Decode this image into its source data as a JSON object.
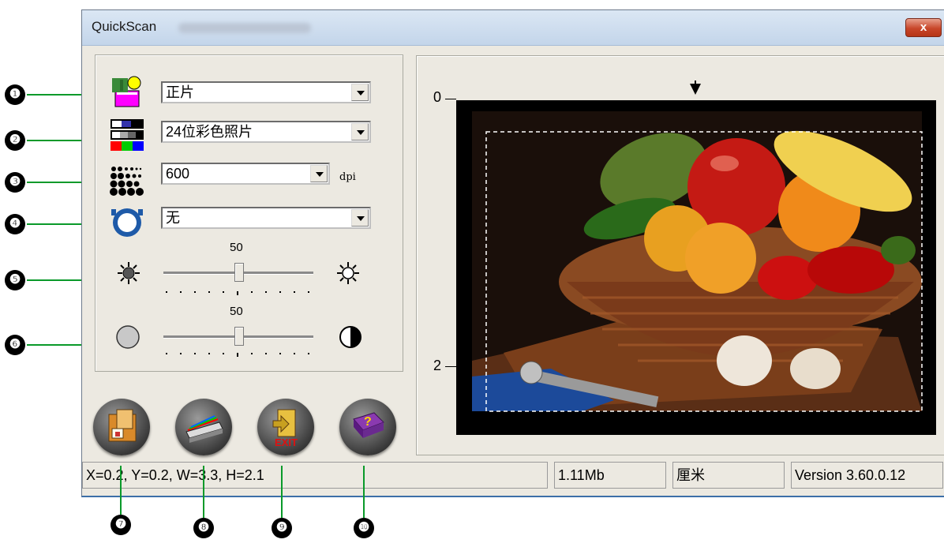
{
  "window": {
    "title": "QuickScan",
    "close_label": "x"
  },
  "settings": {
    "type": {
      "value": "正片",
      "icon": "film-type-icon"
    },
    "mode": {
      "value": "24位彩色照片",
      "icon": "color-mode-icon"
    },
    "resolution": {
      "value": "600",
      "unit": "dpi",
      "icon": "resolution-icon"
    },
    "filter": {
      "value": "无",
      "icon": "lens-filter-icon"
    }
  },
  "brightness": {
    "value": 50,
    "min": 0,
    "max": 100,
    "value_label": "50"
  },
  "contrast": {
    "value": 50,
    "min": 0,
    "max": 100,
    "value_label": "50"
  },
  "ruler": {
    "labels": [
      "0",
      "2"
    ]
  },
  "buttons": [
    {
      "name": "manager",
      "icon": "folder-manager-icon"
    },
    {
      "name": "scan",
      "icon": "scanner-icon"
    },
    {
      "name": "exit",
      "icon": "exit-door-icon"
    },
    {
      "name": "help",
      "icon": "help-book-icon"
    }
  ],
  "status": {
    "coords": "X=0.2, Y=0.2, W=3.3, H=2.1",
    "size": "1.11Mb",
    "unit": "厘米",
    "version": "Version 3.60.0.12"
  },
  "callouts": [
    "❶",
    "❷",
    "❸",
    "❹",
    "❺",
    "❻",
    "❼",
    "❽",
    "❾",
    "❿"
  ],
  "colors": {
    "arrow": "#0a9a2a",
    "accent": "#3d6fa8"
  }
}
